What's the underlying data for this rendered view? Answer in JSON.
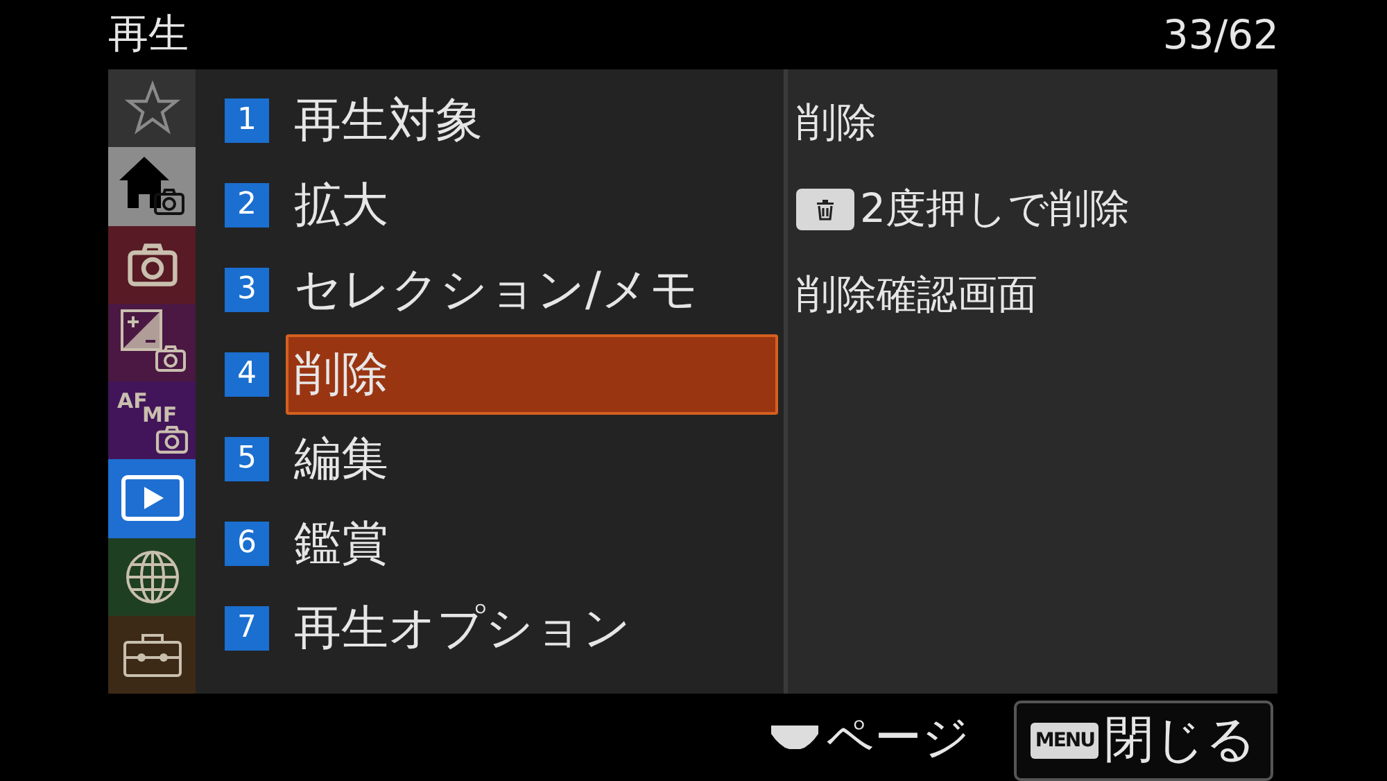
{
  "header": {
    "title": "再生",
    "page": "33/62"
  },
  "sidebar": {
    "items": [
      {
        "kind": "star",
        "color": "#333333",
        "selected": false
      },
      {
        "kind": "home",
        "color": "#8c8c8c",
        "selected": false
      },
      {
        "kind": "camera",
        "color": "#581a24",
        "selected": false
      },
      {
        "kind": "exposure",
        "color": "#4a1842",
        "selected": false
      },
      {
        "kind": "focus",
        "color": "#42155a",
        "selected": false,
        "label": "AF",
        "sub_label": "MF"
      },
      {
        "kind": "play",
        "color": "#1f6fd2",
        "selected": true
      },
      {
        "kind": "globe",
        "color": "#1f3f22",
        "selected": false
      },
      {
        "kind": "toolbox",
        "color": "#3d2a16",
        "selected": false
      }
    ]
  },
  "menu": {
    "items": [
      {
        "number": "1",
        "label": "再生対象",
        "selected": false
      },
      {
        "number": "2",
        "label": "拡大",
        "selected": false
      },
      {
        "number": "3",
        "label": "セレクション/メモ",
        "selected": false
      },
      {
        "number": "4",
        "label": "削除",
        "selected": true
      },
      {
        "number": "5",
        "label": "編集",
        "selected": false
      },
      {
        "number": "6",
        "label": "鑑賞",
        "selected": false
      },
      {
        "number": "7",
        "label": "再生オプション",
        "selected": false
      }
    ]
  },
  "submenu": {
    "items": [
      {
        "label": "削除",
        "kind": "plain"
      },
      {
        "label": "2度押しで削除",
        "kind": "trash"
      },
      {
        "label": "削除確認画面",
        "kind": "plain"
      }
    ]
  },
  "footer": {
    "page_label": "ページ",
    "close": {
      "key": "MENU",
      "label": "閉じる"
    }
  }
}
